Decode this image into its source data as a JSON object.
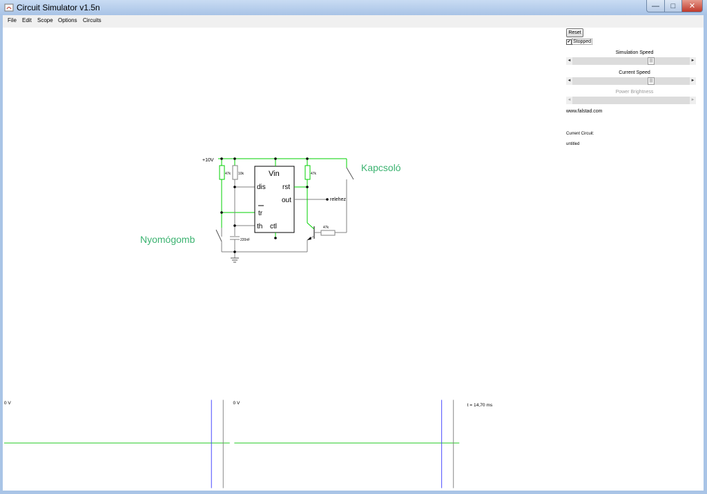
{
  "window": {
    "title": "Circuit Simulator v1.5n",
    "min_glyph": "—",
    "max_glyph": "□",
    "close_glyph": "✕"
  },
  "menu": {
    "items": [
      "File",
      "Edit",
      "Scope",
      "Options",
      "Circuits"
    ]
  },
  "side": {
    "reset_label": "Reset",
    "stopped_label": "Stopped",
    "stopped_checked_glyph": "✔",
    "sim_speed_label": "Simulation Speed",
    "current_speed_label": "Current Speed",
    "power_brightness_label": "Power Brightness",
    "website": "www.falstad.com",
    "current_circuit_label": "Current Circuit:",
    "circuit_name": "untitled",
    "arrow_left": "◄",
    "arrow_right": "►",
    "thumb_grip": "|||"
  },
  "circuit": {
    "supply_label": "+10V",
    "r1_label": "47k",
    "r2_label": "10k",
    "r3_label": "47k",
    "r4_label": "47k",
    "cap_label": "220nF",
    "ic_vin": "Vin",
    "ic_dis": "dis",
    "ic_rst": "rst",
    "ic_out": "out",
    "ic_tr": "tr",
    "ic_th": "th",
    "ic_ctl": "ctl",
    "output_label": "relehez",
    "switch_label": "Kapcsoló",
    "button_label": "Nyomógomb"
  },
  "scope": {
    "left_label": "0 V",
    "right_label": "0 V",
    "time_label": "t = 14,70 ms"
  },
  "colors": {
    "wire_active": "#00d000",
    "wire_idle": "#808080",
    "annotation": "#3cb371",
    "scope_cursor": "#4040ff"
  }
}
